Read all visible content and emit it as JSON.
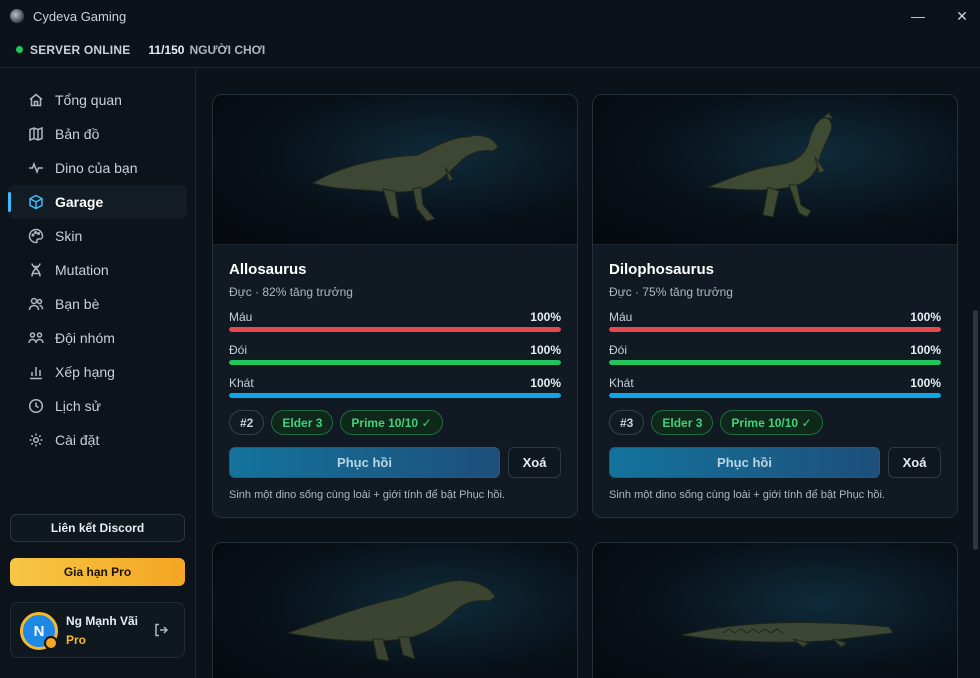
{
  "app": {
    "title": "Cydeva Gaming",
    "minimize_glyph": "—",
    "close_glyph": "✕"
  },
  "status": {
    "label": "SERVER ONLINE",
    "players": "11/150",
    "players_label": "NGƯỜI CHƠI",
    "color": "#22c55e"
  },
  "sidebar": {
    "items": [
      {
        "label": "Tổng quan",
        "icon": "home-icon"
      },
      {
        "label": "Bản đồ",
        "icon": "map-icon"
      },
      {
        "label": "Dino của bạn",
        "icon": "activity-icon"
      },
      {
        "label": "Garage",
        "icon": "cube-icon",
        "active": true
      },
      {
        "label": "Skin",
        "icon": "palette-icon"
      },
      {
        "label": "Mutation",
        "icon": "dna-icon"
      },
      {
        "label": "Bạn bè",
        "icon": "users-icon"
      },
      {
        "label": "Đội nhóm",
        "icon": "team-icon"
      },
      {
        "label": "Xếp hạng",
        "icon": "chart-icon"
      },
      {
        "label": "Lịch sử",
        "icon": "clock-icon"
      },
      {
        "label": "Cài đặt",
        "icon": "gear-icon"
      }
    ],
    "discord_label": "Liên kết Discord",
    "pro_label": "Gia hạn Pro",
    "user": {
      "initial": "N",
      "name": "Ng Mạnh Vãi",
      "tier": "Pro"
    }
  },
  "accent_color": "#38bdf8",
  "cards": [
    {
      "name": "Allosaurus",
      "meta": "Đực · 82% tăng trưởng",
      "stats": [
        {
          "label": "Máu",
          "value": "100%",
          "fraction": 1.0,
          "color": "#e5484d"
        },
        {
          "label": "Đói",
          "value": "100%",
          "fraction": 1.0,
          "color": "#22c55e"
        },
        {
          "label": "Khát",
          "value": "100%",
          "fraction": 1.0,
          "color": "#0ea5e9"
        }
      ],
      "tags": [
        "#2",
        "Elder 3",
        "Prime 10/10 ✓"
      ],
      "restore_label": "Phục hồi",
      "delete_label": "Xoá",
      "hint": "Sinh một dino sống cùng loài + giới tính để bật Phục hồi."
    },
    {
      "name": "Dilophosaurus",
      "meta": "Đực · 75% tăng trưởng",
      "stats": [
        {
          "label": "Máu",
          "value": "100%",
          "fraction": 1.0,
          "color": "#e5484d"
        },
        {
          "label": "Đói",
          "value": "100%",
          "fraction": 1.0,
          "color": "#22c55e"
        },
        {
          "label": "Khát",
          "value": "100%",
          "fraction": 1.0,
          "color": "#0ea5e9"
        }
      ],
      "tags": [
        "#3",
        "Elder 3",
        "Prime 10/10 ✓"
      ],
      "restore_label": "Phục hồi",
      "delete_label": "Xoá",
      "hint": "Sinh một dino sống cùng loài + giới tính để bật Phục hồi."
    }
  ]
}
